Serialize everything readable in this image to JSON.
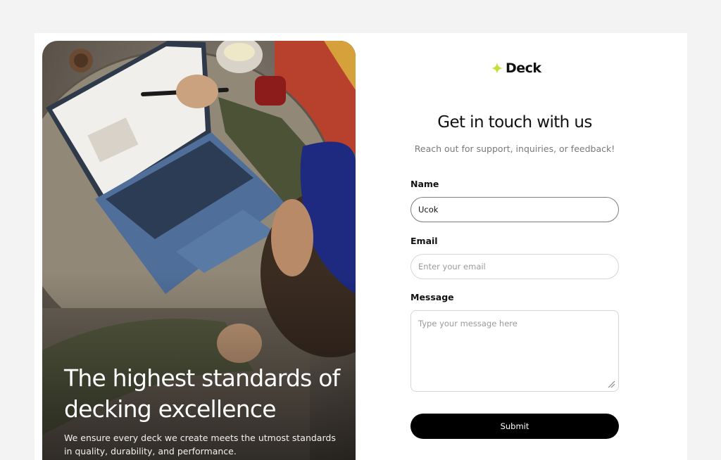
{
  "brand": {
    "name": "Deck",
    "icon": "sparkle-icon",
    "accent": "#c9dd3c"
  },
  "hero": {
    "title": "The highest standards of decking excellence",
    "subtitle": "We ensure every deck we create meets the utmost standards in quality, durability, and performance."
  },
  "form": {
    "title": "Get in touch with us",
    "subtitle": "Reach out for support, inquiries, or feedback!",
    "name_label": "Name",
    "name_value": "Ucok",
    "email_label": "Email",
    "email_placeholder": "Enter your email",
    "message_label": "Message",
    "message_placeholder": "Type your message here",
    "submit_label": "Submit"
  },
  "colors": {
    "page_bg": "#f3f3f3",
    "button_bg": "#000000",
    "text": "#111111",
    "muted": "#7a7a7a"
  }
}
